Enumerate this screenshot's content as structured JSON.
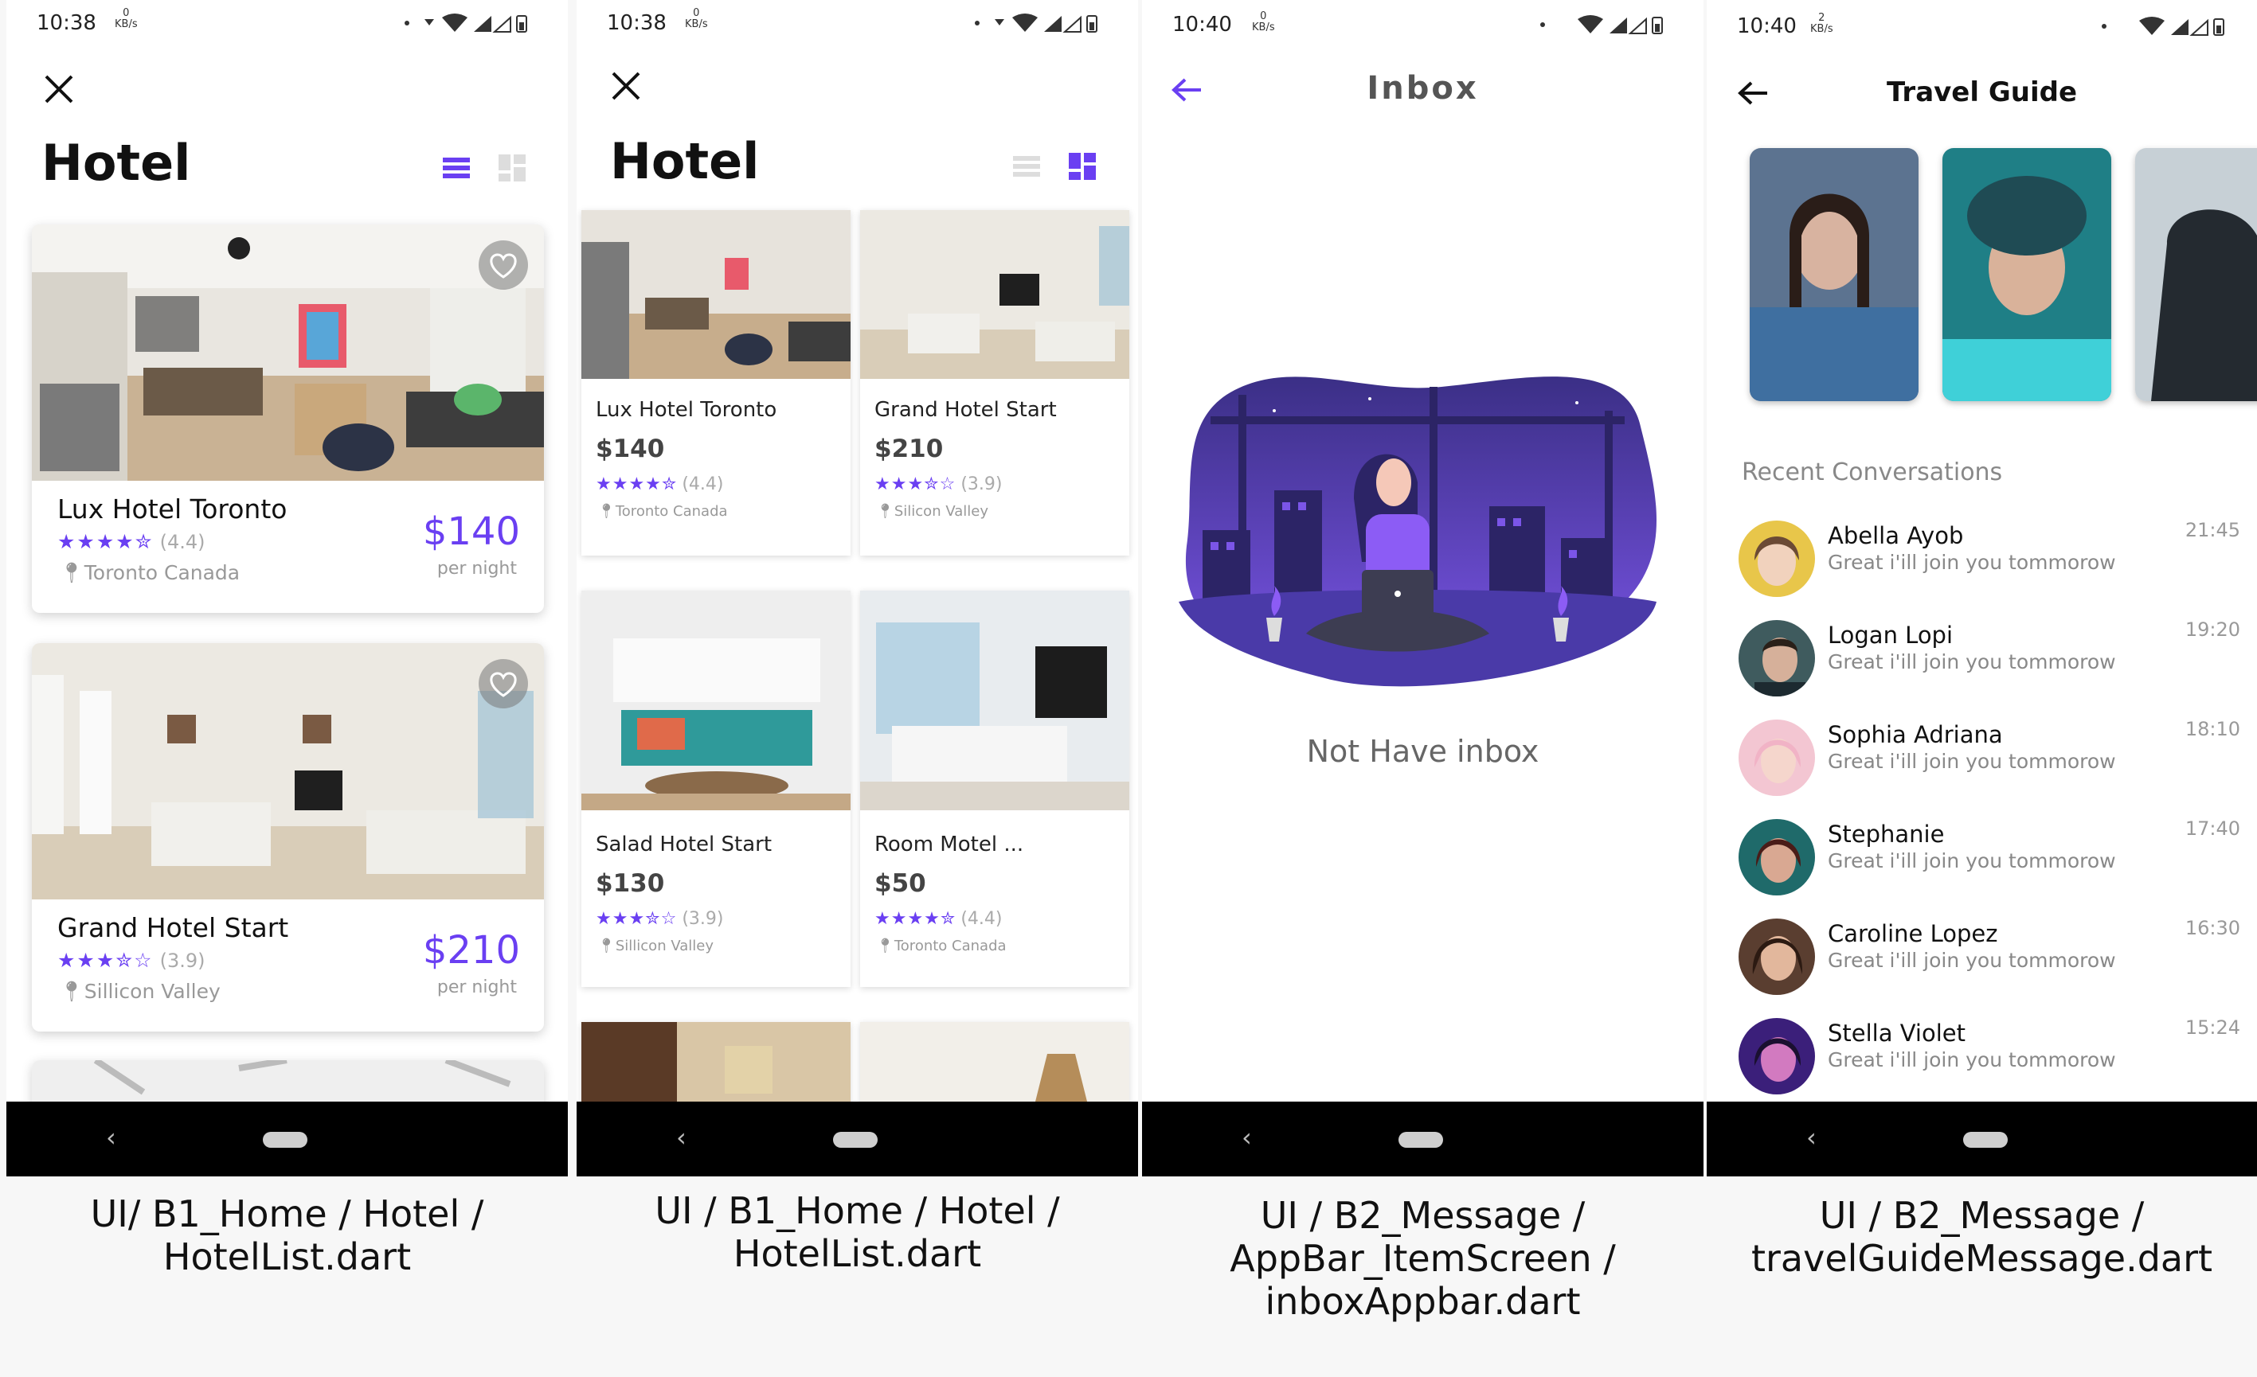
{
  "statusbars": [
    "10:38",
    "10:38",
    "10:40",
    "10:40"
  ],
  "kbs": [
    {
      "top": "0",
      "bottom": "KB/s"
    },
    {
      "top": "0",
      "bottom": "KB/s"
    },
    {
      "top": "0",
      "bottom": "KB/s"
    },
    {
      "top": "2",
      "bottom": "KB/s"
    }
  ],
  "hotel_list": {
    "title": "Hotel",
    "cards": [
      {
        "name": "Lux Hotel Toronto",
        "stars": "★★★★✮",
        "rating": "(4.4)",
        "location": "Toronto Canada",
        "price": "$140",
        "unit": "per night"
      },
      {
        "name": "Grand Hotel Start",
        "stars": "★★★✮☆",
        "rating": "(3.9)",
        "location": "Sillicon Valley",
        "price": "$210",
        "unit": "per night"
      }
    ],
    "caption": [
      "UI/  B1_Home / Hotel /",
      "HotelList.dart"
    ]
  },
  "hotel_grid": {
    "title": "Hotel",
    "cards": [
      {
        "name": "Lux Hotel Toronto",
        "price": "$140",
        "stars": "★★★★✮",
        "rating": "(4.4)",
        "location": "Toronto Canada"
      },
      {
        "name": "Grand Hotel Start",
        "price": "$210",
        "stars": "★★★✮☆",
        "rating": "(3.9)",
        "location": "Silicon Valley"
      },
      {
        "name": "Salad Hotel Start",
        "price": "$130",
        "stars": "★★★✮☆",
        "rating": "(3.9)",
        "location": "Sillicon Valley"
      },
      {
        "name": "Room Motel ...",
        "price": "$50",
        "stars": "★★★★✮",
        "rating": "(4.4)",
        "location": "Toronto Canada"
      }
    ],
    "caption": [
      "UI /  B1_Home / Hotel /",
      "HotelList.dart"
    ]
  },
  "inbox": {
    "title": "Inbox",
    "empty": "Not Have inbox",
    "caption": [
      "UI /  B2_Message /",
      "AppBar_ItemScreen /",
      "inboxAppbar.dart"
    ]
  },
  "travel": {
    "title": "Travel Guide",
    "section": "Recent Conversations",
    "conversations": [
      {
        "name": "Abella Ayob",
        "message": "Great i'ill join you tommorow",
        "time": "21:45"
      },
      {
        "name": "Logan Lopi",
        "message": "Great i'ill join you tommorow",
        "time": "19:20"
      },
      {
        "name": "Sophia Adriana",
        "message": "Great i'ill join you tommorow",
        "time": "18:10"
      },
      {
        "name": "Stephanie",
        "message": "Great i'ill join you tommorow",
        "time": "17:40"
      },
      {
        "name": "Caroline Lopez",
        "message": "Great i'ill join you tommorow",
        "time": "16:30"
      },
      {
        "name": "Stella Violet",
        "message": "Great i'ill join you tommorow",
        "time": "15:24"
      }
    ],
    "caption": [
      "UI /  B2_Message /",
      "travelGuideMessage.dart"
    ]
  },
  "colors": {
    "accent": "#6a3ff2",
    "navbar": "#000000",
    "background": "#f7f7f7"
  }
}
